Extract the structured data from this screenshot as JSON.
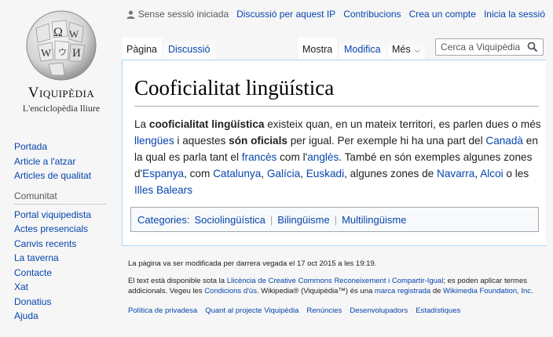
{
  "logo": {
    "wordmark": "Viquipèdia",
    "tagline": "L'enciclopèdia lliure"
  },
  "personal": {
    "not_logged_in": "Sense sessió iniciada",
    "talk": "Discussió per aquest IP",
    "contributions": "Contribucions",
    "create_account": "Crea un compte",
    "login": "Inicia la sessió"
  },
  "tabs": {
    "page": "Pàgina",
    "talk": "Discussió",
    "view": "Mostra",
    "edit": "Modifica",
    "more": "Més",
    "search_placeholder": "Cerca a Viquipèdia"
  },
  "sidebar": {
    "nav": [
      "Portada",
      "Article a l'atzar",
      "Articles de qualitat"
    ],
    "community_heading": "Comunitat",
    "community": [
      "Portal viquipedista",
      "Actes presencials",
      "Canvis recents",
      "La taverna",
      "Contacte",
      "Xat",
      "Donatius",
      "Ajuda"
    ]
  },
  "article": {
    "title": "Cooficialitat lingüística",
    "p": {
      "t1": "La ",
      "b1": "cooficialitat lingüística",
      "t2": " existeix quan, en un mateix territori, es parlen dues o més ",
      "l1": "llengües",
      "t3": " i aquestes ",
      "b2": "són oficials",
      "t4": " per igual. Per exemple hi ha una part del ",
      "l2": "Canadà",
      "t5": " en la qual es parla tant el ",
      "l3": "francès",
      "t6": " com l'",
      "l4": "anglès",
      "t7": ". També en són exemples algunes zones d'",
      "l5": "Espanya",
      "t8": ", com ",
      "l6": "Catalunya",
      "t9": ", ",
      "l7": "Galícia",
      "t10": ", ",
      "l8": "Euskadi",
      "t11": ", algunes zones de ",
      "l9": "Navarra",
      "t12": ", ",
      "l10": "Alcoi",
      "t13": " o les ",
      "l11": "Illes Balears"
    },
    "categories_label": "Categories:",
    "categories": [
      "Sociolingüística",
      "Bilingüisme",
      "Multilingüisme"
    ]
  },
  "footer": {
    "lastmod": "La pàgina va ser modificada per darrera vegada el 17 oct 2015 a les 19:19.",
    "license": {
      "t1": "El text està disponible sota la ",
      "l1": "Llicència de Creative Commons Reconeixement i Compartir-Igual",
      "t2": "; es poden aplicar termes addicionals. Vegeu les ",
      "l2": "Condicions d'ús",
      "t3": ". Wikipedia® (Viquipèdia™) és una ",
      "l3": "marca registrada",
      "t4": " de ",
      "l4": "Wikimedia Foundation, Inc",
      "t5": "."
    },
    "places": [
      "Política de privadesa",
      "Quant al projecte Viquipèdia",
      "Renúncies",
      "Desenvolupadors",
      "Estadístiques"
    ]
  }
}
